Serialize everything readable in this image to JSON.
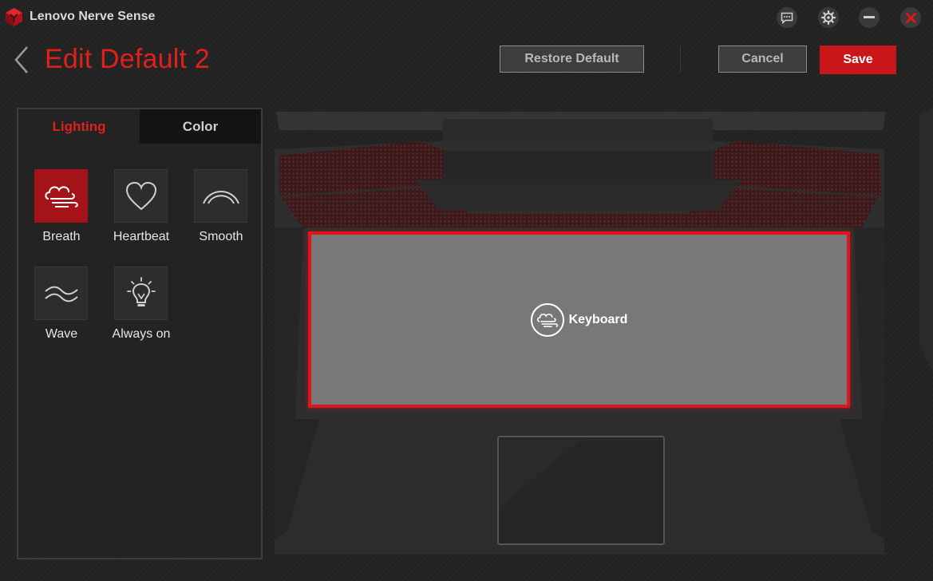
{
  "window": {
    "app_title": "Lenovo Nerve Sense",
    "controls": [
      {
        "name": "feedback-icon"
      },
      {
        "name": "settings-gear-icon"
      },
      {
        "name": "minimize-icon"
      },
      {
        "name": "close-icon"
      }
    ]
  },
  "header": {
    "title": "Edit Default 2",
    "restore_label": "Restore Default",
    "cancel_label": "Cancel",
    "save_label": "Save"
  },
  "panel": {
    "tabs": [
      {
        "label": "Lighting",
        "active": true
      },
      {
        "label": "Color",
        "active": false
      }
    ],
    "effects": [
      {
        "label": "Breath",
        "icon": "breath-icon",
        "selected": true
      },
      {
        "label": "Heartbeat",
        "icon": "heart-icon",
        "selected": false
      },
      {
        "label": "Smooth",
        "icon": "smooth-arc-icon",
        "selected": false
      },
      {
        "label": "Wave",
        "icon": "wave-icon",
        "selected": false
      },
      {
        "label": "Always on",
        "icon": "lightbulb-icon",
        "selected": false
      }
    ]
  },
  "zone": {
    "label": "Keyboard",
    "icon": "breath-icon",
    "selected": true
  },
  "colors": {
    "accent": "#e0201d",
    "selected_tile": "#a31318",
    "save_button": "#c8161b",
    "background": "#222222",
    "keyboard_zone": "#787878"
  }
}
